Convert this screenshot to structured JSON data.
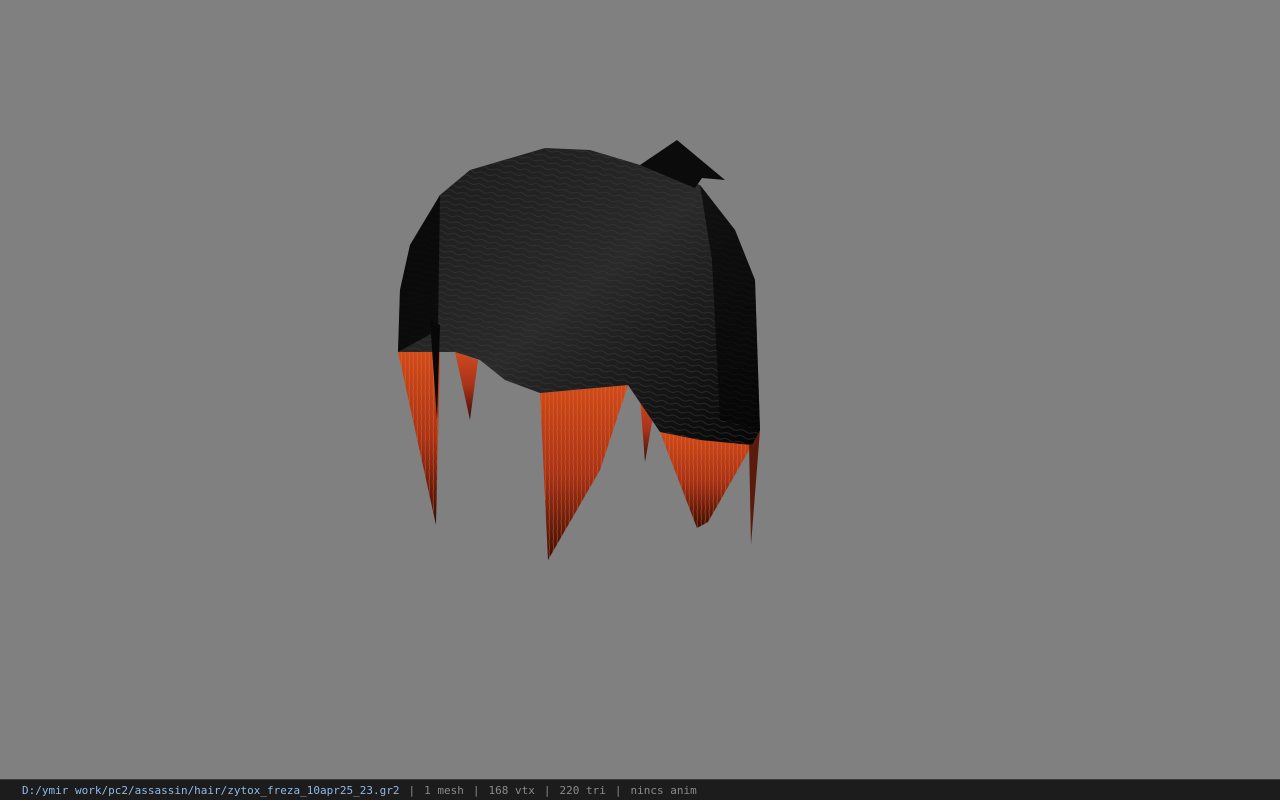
{
  "viewport": {
    "background_color": "#808080",
    "model": {
      "hair_color": "#0d0d0d",
      "tip_color": "#c0401a"
    }
  },
  "statusbar": {
    "file_path": "D:/ymir work/pc2/assassin/hair/zytox_freza_10apr25_23.gr2",
    "separator": "|",
    "mesh_count": "1 mesh",
    "vertex_count": "168 vtx",
    "triangle_count": "220 tri",
    "anim_status": "nincs anim"
  }
}
